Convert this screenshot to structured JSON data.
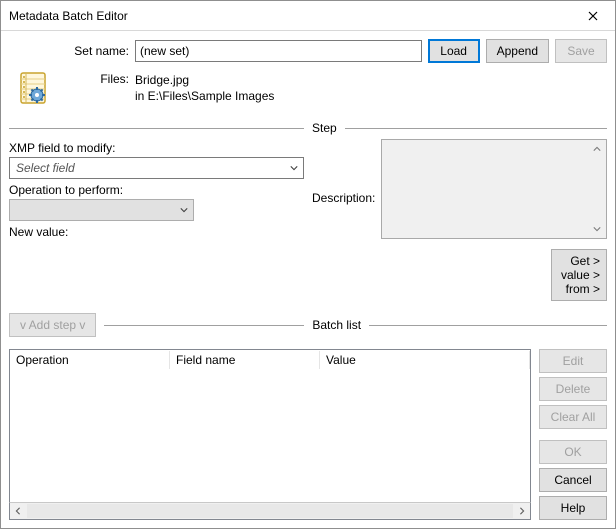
{
  "window": {
    "title": "Metadata Batch Editor"
  },
  "top": {
    "setname_label": "Set name:",
    "setname_value": "(new set)",
    "load_label": "Load",
    "append_label": "Append",
    "save_label": "Save"
  },
  "files": {
    "label": "Files:",
    "filename": "Bridge.jpg",
    "location": "in E:\\Files\\Sample Images"
  },
  "step": {
    "legend": "Step",
    "xmp_label": "XMP field to modify:",
    "xmp_placeholder": "Select field",
    "op_label": "Operation to perform:",
    "op_value": "",
    "newval_label": "New value:",
    "description_label": "Description:",
    "description_text": "",
    "getvalue_line1": "Get >",
    "getvalue_line2": "value >",
    "getvalue_line3": "from >"
  },
  "batch": {
    "addstep_label": "v Add step v",
    "legend": "Batch list",
    "columns": {
      "operation": "Operation",
      "fieldname": "Field name",
      "value": "Value"
    },
    "rows": []
  },
  "buttons": {
    "edit": "Edit",
    "delete": "Delete",
    "clearall": "Clear All",
    "ok": "OK",
    "cancel": "Cancel",
    "help": "Help"
  }
}
